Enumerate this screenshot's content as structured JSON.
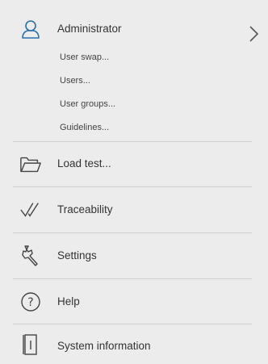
{
  "menu": {
    "administrator": {
      "label": "Administrator",
      "sub_items": [
        "User swap...",
        "Users...",
        "User groups...",
        "Guidelines..."
      ]
    },
    "items": [
      {
        "label": "Load test...",
        "icon": "folder-icon"
      },
      {
        "label": "Traceability",
        "icon": "double-check-icon"
      },
      {
        "label": "Settings",
        "icon": "wrench-icon"
      },
      {
        "label": "Help",
        "icon": "help-icon"
      },
      {
        "label": "System information",
        "icon": "info-icon"
      }
    ]
  },
  "colors": {
    "background": "#ececec",
    "accent": "#2a6fb0",
    "separator": "#cfcfcf",
    "text": "#333333"
  }
}
